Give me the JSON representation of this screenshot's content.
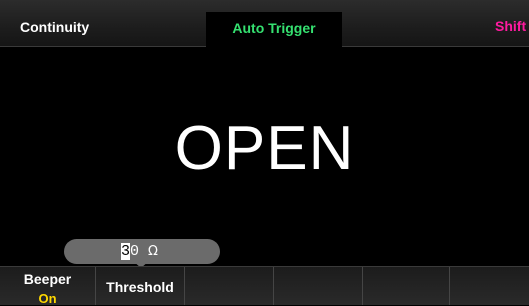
{
  "header": {
    "mode": "Continuity",
    "trigger": "Auto Trigger",
    "shift": "Shift"
  },
  "colors": {
    "trigger": "#35e070",
    "shift": "#ff1aa0",
    "softkey_value": "#ffd800"
  },
  "display": {
    "reading": "OPEN"
  },
  "threshold_editor": {
    "cursor_digit": "3",
    "rest_digits": "0",
    "unit": "Ω"
  },
  "softkeys": [
    {
      "label": "Beeper",
      "value": "On"
    },
    {
      "label": "Threshold",
      "value": ""
    },
    {
      "label": "",
      "value": ""
    },
    {
      "label": "",
      "value": ""
    },
    {
      "label": "",
      "value": ""
    },
    {
      "label": "",
      "value": ""
    }
  ]
}
